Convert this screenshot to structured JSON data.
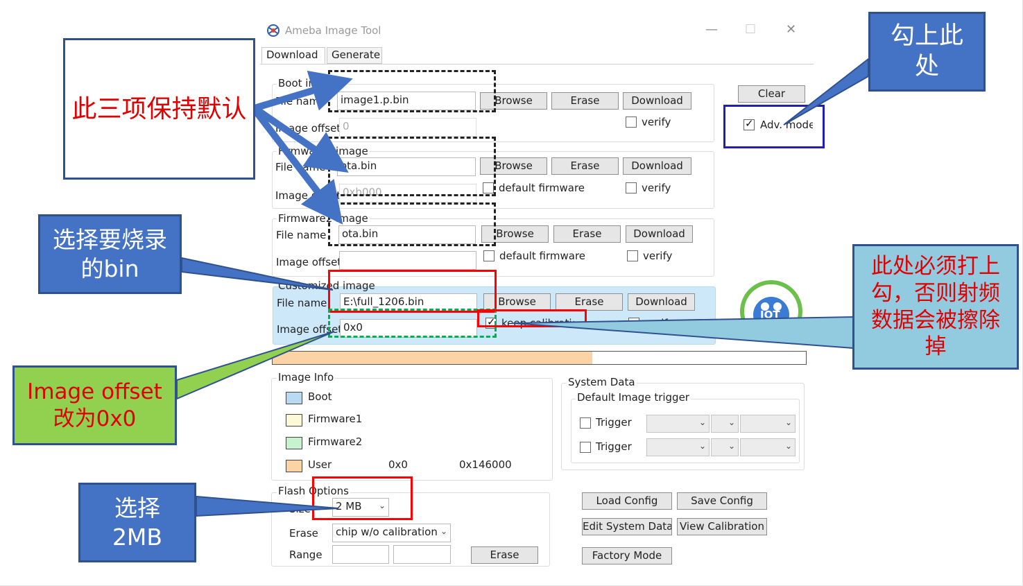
{
  "window": {
    "title": "Ameba Image Tool",
    "minimize_glyph": "—",
    "maximize_glyph": "☐",
    "close_glyph": "✕"
  },
  "tabs": [
    "Download",
    "Generate"
  ],
  "boot_image": {
    "title": "Boot image",
    "file_name_label": "File name",
    "file_name": "image1.p.bin",
    "offset_label": "Image offset",
    "offset": "0",
    "browse": "Browse",
    "erase": "Erase",
    "download": "Download",
    "verify": "verify"
  },
  "firmware1": {
    "title": "Firmware1 image",
    "file_name_label": "File name",
    "file_name": "ota.bin",
    "offset_label": "Image offset",
    "offset": "0xb000",
    "browse": "Browse",
    "erase": "Erase",
    "download": "Download",
    "default_firmware": "default firmware",
    "verify": "verify"
  },
  "firmware2": {
    "title": "Firmware2 image",
    "file_name_label": "File name",
    "file_name": "ota.bin",
    "offset_label": "Image offset",
    "offset": "",
    "browse": "Browse",
    "erase": "Erase",
    "download": "Download",
    "default_firmware": "default firmware",
    "verify": "verify"
  },
  "custom_image": {
    "title": "Customized image",
    "file_name_label": "File name",
    "file_name": "E:\\full_1206.bin",
    "offset_label": "Image offset",
    "offset": "0x0",
    "browse": "Browse",
    "erase": "Erase",
    "download": "Download",
    "keep_calibration": "keep calibration",
    "verify": "verify"
  },
  "right_panel": {
    "clear": "Clear",
    "adv_mode": "Adv. mode",
    "logo_text": "IOT"
  },
  "progress": {
    "value": 0.6
  },
  "image_info": {
    "title": "Image Info",
    "items": [
      {
        "label": "Boot",
        "color": "#b8daf4"
      },
      {
        "label": "Firmware1",
        "color": "#fdf8d6"
      },
      {
        "label": "Firmware2",
        "color": "#c6f2cf"
      },
      {
        "label": "User",
        "color": "#fcd3a4",
        "start": "0x0",
        "end": "0x146000"
      }
    ]
  },
  "system_data": {
    "title": "System Data",
    "trigger_group": "Default Image trigger",
    "trigger1": "Trigger",
    "trigger2": "Trigger"
  },
  "flash_options": {
    "title": "Flash Options",
    "size_label": "Size",
    "size": "2 MB",
    "erase_label": "Erase",
    "erase_mode": "chip w/o calibration",
    "range_label": "Range",
    "erase_button": "Erase"
  },
  "config_buttons": {
    "load": "Load Config",
    "save": "Save Config",
    "edit": "Edit System Data",
    "view": "View Calibration",
    "factory": "Factory Mode"
  },
  "callouts": {
    "keep_default": "此三项保持默认",
    "check_here": "勾上此处",
    "select_bin": "选择要烧录的bin",
    "must_check": "此处必须打上勾，否则射频数据会被擦除掉",
    "offset_line1": "Image offset",
    "offset_line2": "改为0x0",
    "select_2mb_line1": "选择",
    "select_2mb_line2": "2MB"
  },
  "colors": {
    "callout_blue": "#4472c4",
    "callout_border": "#2f528f",
    "callout_green": "#92d050",
    "callout_light": "#92cbe0",
    "red_text": "#e00000",
    "highlight_row": "#cde8f8",
    "progress_fill": "#fcd3a4"
  }
}
